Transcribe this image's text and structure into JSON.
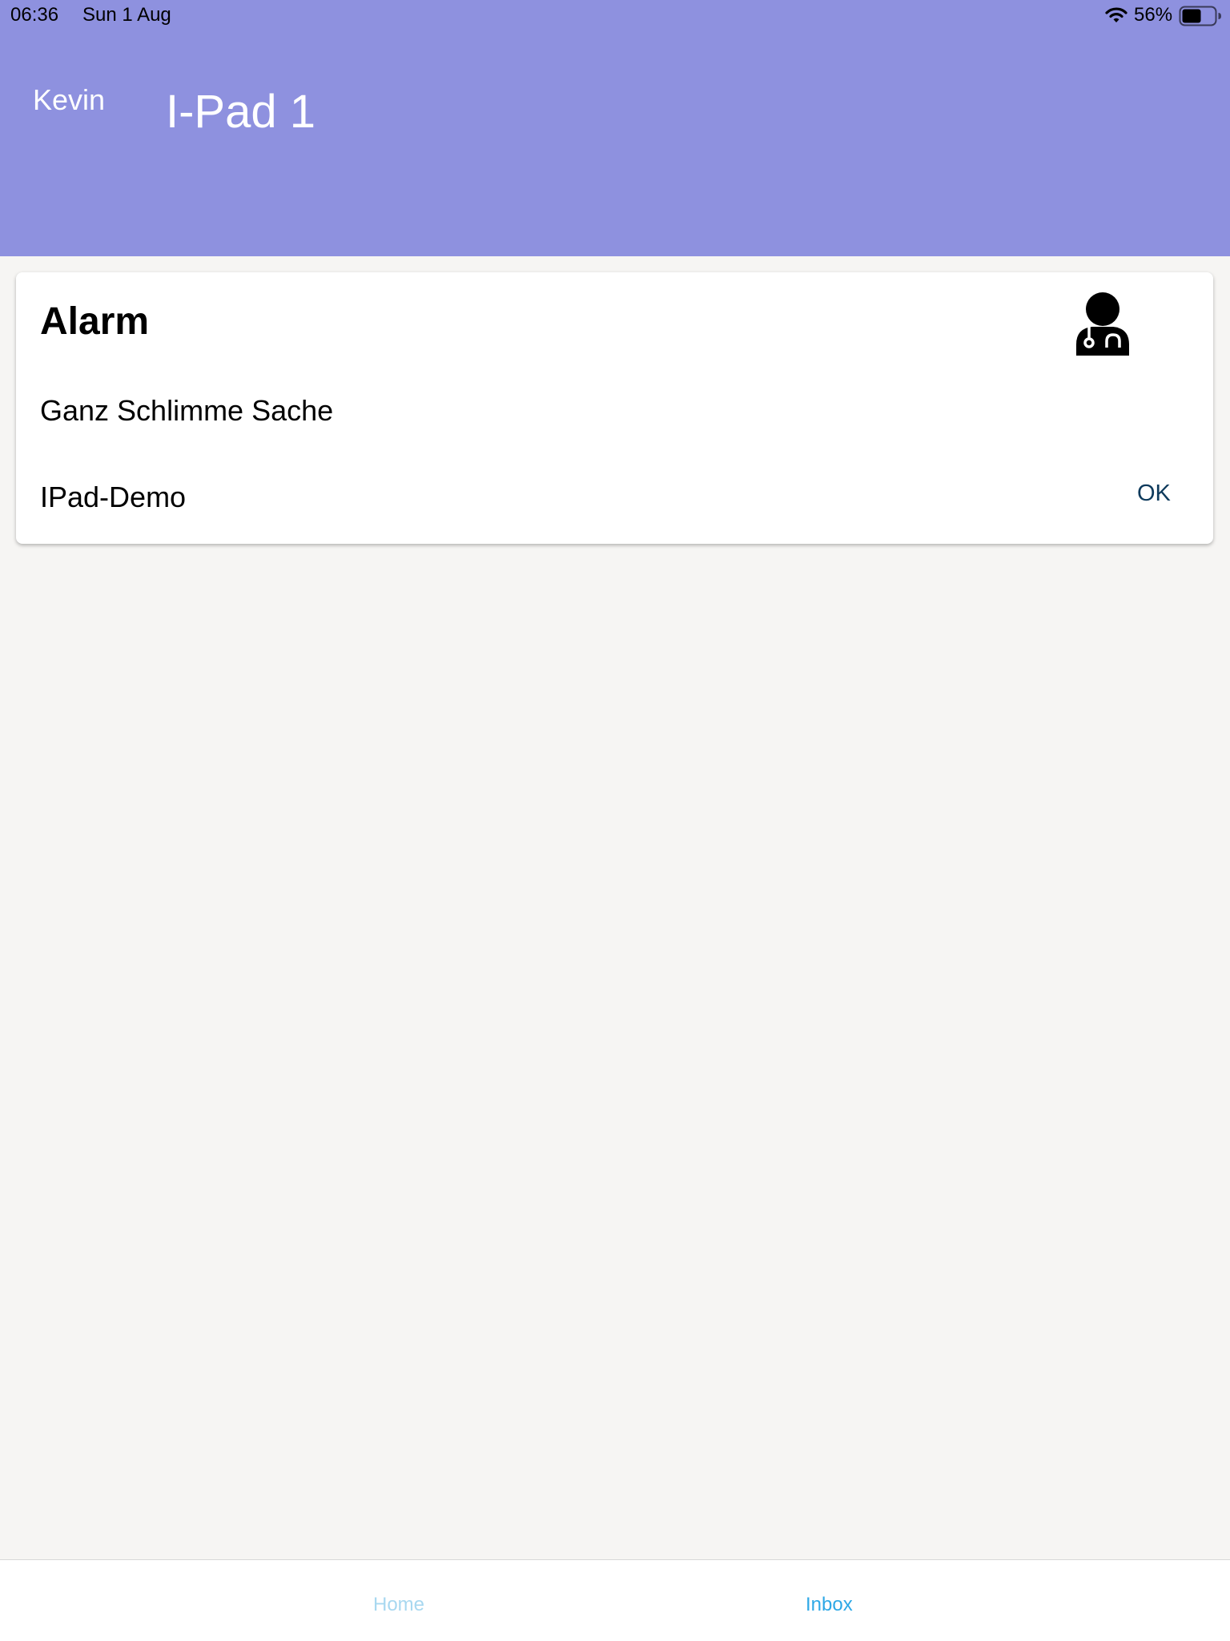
{
  "status_bar": {
    "time": "06:36",
    "date": "Sun 1 Aug",
    "battery": "56%",
    "wifi_icon": "wifi-icon",
    "battery_icon": "battery-icon",
    "battery_level": 0.56
  },
  "header": {
    "user": "Kevin",
    "title": "I-Pad 1",
    "background_color": "#8e91df"
  },
  "card": {
    "title": "Alarm",
    "icon": "doctor-icon",
    "message": "Ganz Schlimme Sache",
    "source": "IPad-Demo",
    "ok_label": "OK"
  },
  "tabs": [
    {
      "label": "Home",
      "active": false,
      "color": "#a8d8f0"
    },
    {
      "label": "Inbox",
      "active": true,
      "color": "#2ea8e6"
    }
  ]
}
